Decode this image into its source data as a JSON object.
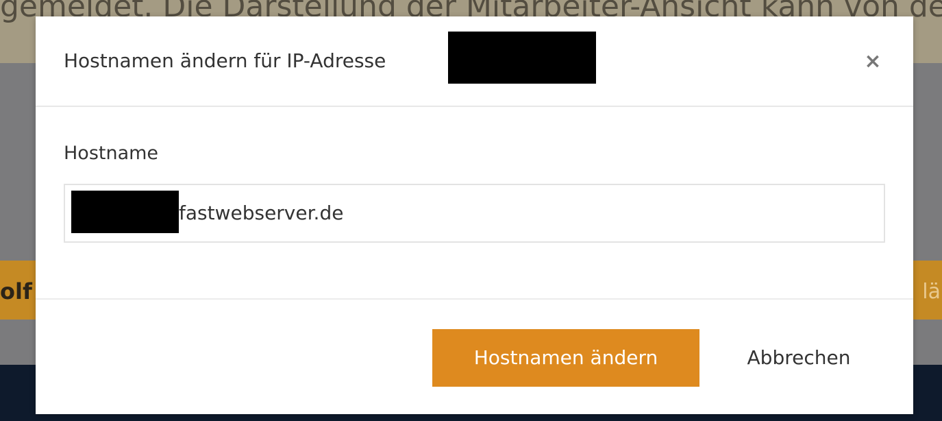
{
  "background": {
    "banner_text": "gemeldet. Die Darstellung der Mitarbeiter-Ansicht kann von der Ku",
    "orange_left_text": "olf",
    "orange_right_text": "lä"
  },
  "dialog": {
    "title": "Hostnamen ändern für IP-Adresse",
    "close_glyph": "×",
    "field_label": "Hostname",
    "hostname_value": "fastwebserver.de",
    "submit_label": "Hostnamen ändern",
    "cancel_label": "Abbrechen"
  },
  "colors": {
    "primary_button": "#de8a1f",
    "overlay_orange": "#c58a24",
    "footer_navy": "#0e1a2c"
  }
}
